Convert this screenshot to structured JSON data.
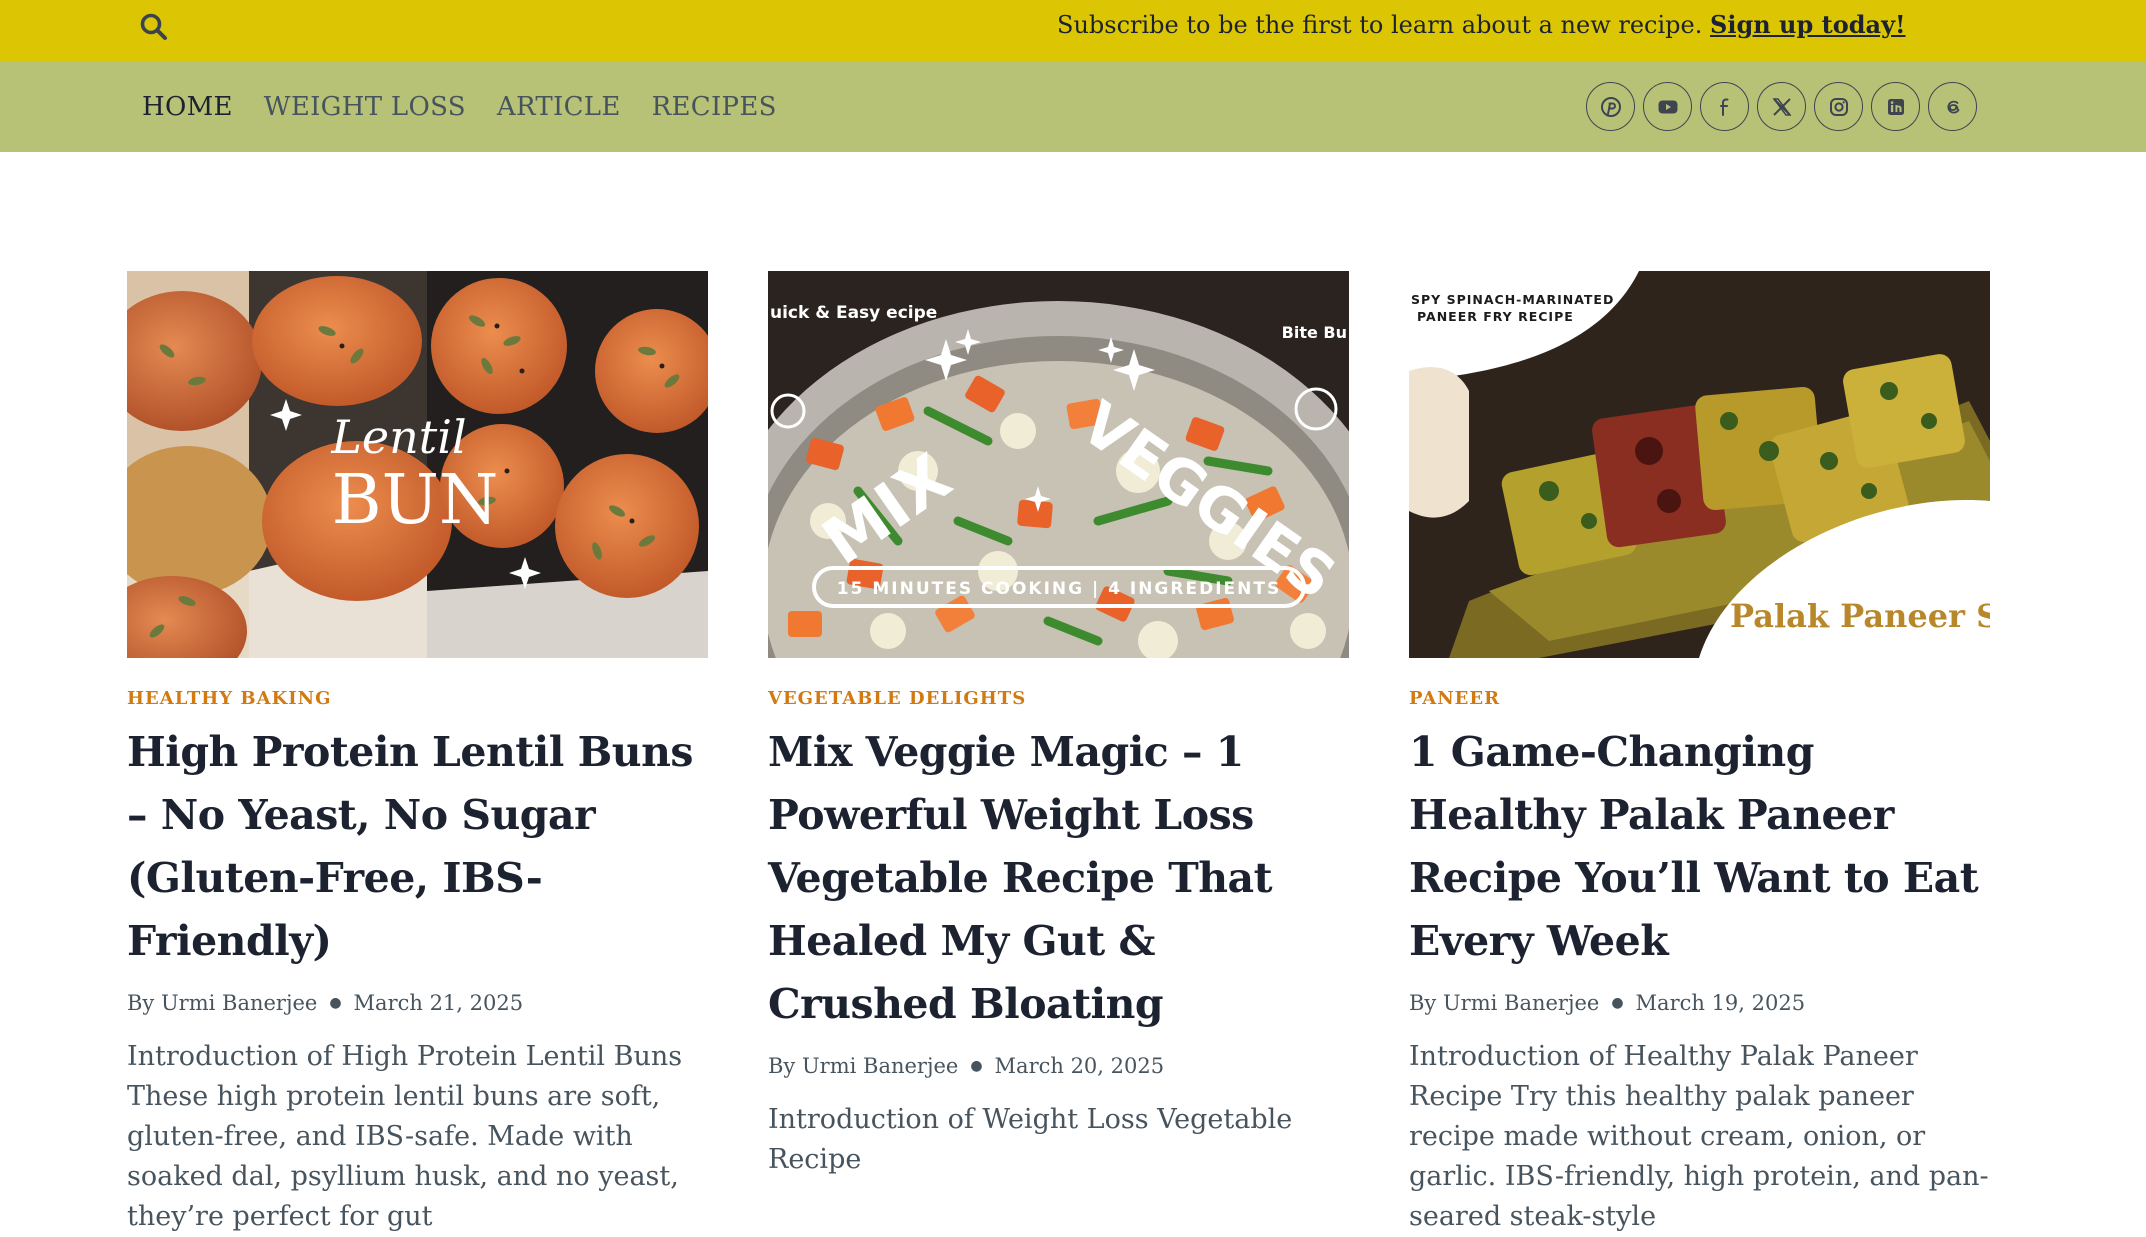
{
  "colors": {
    "topbar_bg": "#dcc604",
    "nav_bg": "#b8c277",
    "category_accent": "#d27a12",
    "title_text": "#1c2230",
    "body_text": "#47545e"
  },
  "topbar": {
    "search_icon": "search-icon",
    "notice_text": "Subscribe to be the first to learn about a new recipe.",
    "notice_link": "Sign up today!"
  },
  "nav": {
    "menu": [
      {
        "label": "HOME",
        "active": true
      },
      {
        "label": "WEIGHT LOSS",
        "active": false
      },
      {
        "label": "ARTICLE",
        "active": false
      },
      {
        "label": "RECIPES",
        "active": false
      }
    ],
    "social_icons": [
      "pinterest-icon",
      "youtube-icon",
      "facebook-icon",
      "x-icon",
      "instagram-icon",
      "linkedin-icon",
      "threads-icon"
    ]
  },
  "posts": [
    {
      "image_text": {
        "script": "Lentil",
        "main": "BUN"
      },
      "category": "HEALTHY BAKING",
      "title": "High Protein Lentil Buns – No Yeast, No Sugar (Gluten-Free, IBS-Friendly)",
      "author": "By Urmi Banerjee",
      "date": "March 21, 2025",
      "excerpt": "Introduction of High Protein Lentil Buns These high protein lentil buns are soft, gluten-free, and IBS-safe. Made with soaked dal, psyllium husk, and no yeast, they’re perfect for gut"
    },
    {
      "image_text": {
        "corner_left": "uick & Easy ecipe",
        "corner_right": "Bite Bu",
        "main_left": "MIX",
        "main_right": "VEGGIES",
        "badge": "15 MINUTES COOKING | 4 INGREDIENTS"
      },
      "category": "VEGETABLE DELIGHTS",
      "title": "Mix Veggie Magic – 1 Powerful Weight Loss Vegetable Recipe That Healed My Gut & Crushed Bloating",
      "author": "By Urmi Banerjee",
      "date": "March 20, 2025",
      "excerpt": "Introduction of Weight Loss Vegetable Recipe"
    },
    {
      "image_text": {
        "header_line1": "SPY SPINACH-MARINATED",
        "header_line2": "PANEER FRY RECIPE",
        "footer": "Palak Paneer Ste"
      },
      "category": "PANEER",
      "title": "1 Game-Changing Healthy Palak Paneer Recipe You’ll Want to Eat Every Week",
      "author": "By Urmi Banerjee",
      "date": "March 19, 2025",
      "excerpt": "Introduction of Healthy Palak Paneer Recipe Try this healthy palak paneer recipe made without cream, onion, or garlic. IBS-friendly, high protein, and pan-seared steak-style"
    }
  ]
}
